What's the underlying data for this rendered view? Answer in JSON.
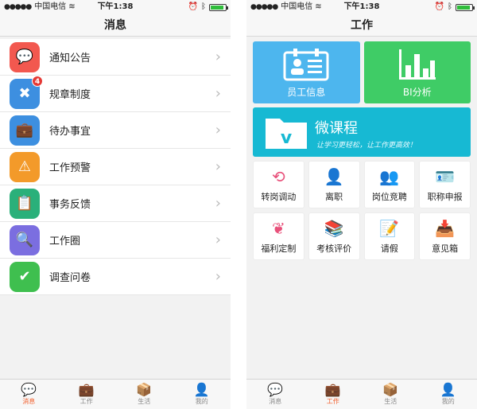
{
  "status": {
    "dots": "●●●●●",
    "carrier": "中国电信",
    "time": "下午1:38"
  },
  "left": {
    "title": "消息",
    "items": [
      {
        "label": "通知公告",
        "color": "#f2584f",
        "icon": "chat-bubble-icon",
        "glyph": "💬"
      },
      {
        "label": "规章制度",
        "color": "#3d8fe0",
        "icon": "rules-icon",
        "glyph": "✖",
        "badge": "4"
      },
      {
        "label": "待办事宜",
        "color": "#3d8fe0",
        "icon": "briefcase-icon",
        "glyph": "💼"
      },
      {
        "label": "工作预警",
        "color": "#f39a2a",
        "icon": "toggle-icon",
        "glyph": "⚠"
      },
      {
        "label": "事务反馈",
        "color": "#2ab07a",
        "icon": "clipboard-icon",
        "glyph": "📋"
      },
      {
        "label": "工作圈",
        "color": "#7b6ee0",
        "icon": "jobs-search-icon",
        "glyph": "🔍"
      },
      {
        "label": "调查问卷",
        "color": "#3fbf4f",
        "icon": "checklist-icon",
        "glyph": "✔"
      }
    ],
    "active_tab": 0
  },
  "right": {
    "title": "工作",
    "big_tiles": [
      {
        "label": "员工信息",
        "color": "#4db6ee",
        "icon": "id-card-icon"
      },
      {
        "label": "BI分析",
        "color": "#3fcc66",
        "icon": "bar-chart-icon"
      }
    ],
    "wide_tile": {
      "title": "微课程",
      "subtitle": "让学习更轻松，让工作更高效！",
      "color": "#17b9d3",
      "icon": "folder-video-icon"
    },
    "small_tiles": [
      {
        "label": "转岗调动",
        "icon": "transfer-icon",
        "glyph": "⟲",
        "color": "#e8507a"
      },
      {
        "label": "离职",
        "icon": "leave-icon",
        "glyph": "👤",
        "color": "#5b8fd6"
      },
      {
        "label": "岗位竞聘",
        "icon": "team-icon",
        "glyph": "👥",
        "color": "#f39a2a"
      },
      {
        "label": "职称申报",
        "icon": "certificate-icon",
        "glyph": "🪪",
        "color": "#7b6ee0"
      },
      {
        "label": "福利定制",
        "icon": "gift-icon",
        "glyph": "❦",
        "color": "#e8507a"
      },
      {
        "label": "考核评价",
        "icon": "binders-icon",
        "glyph": "📚",
        "color": "#3d8fe0"
      },
      {
        "label": "请假",
        "icon": "form-edit-icon",
        "glyph": "📝",
        "color": "#f2584f"
      },
      {
        "label": "意见箱",
        "icon": "suggestion-box-icon",
        "glyph": "📥",
        "color": "#2ab07a"
      }
    ],
    "active_tab": 1
  },
  "tabs": [
    {
      "label": "消息",
      "icon": "message-tab-icon",
      "glyph": "💬"
    },
    {
      "label": "工作",
      "icon": "work-tab-icon",
      "glyph": "💼"
    },
    {
      "label": "生活",
      "icon": "life-tab-icon",
      "glyph": "📦"
    },
    {
      "label": "我的",
      "icon": "profile-tab-icon",
      "glyph": "👤"
    }
  ],
  "accent": "#f25d2a"
}
